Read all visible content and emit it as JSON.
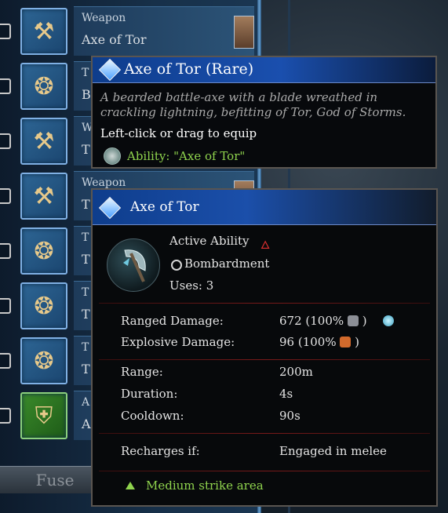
{
  "inventory": {
    "rows": [
      {
        "type": "Weapon",
        "name": "Axe of Tor",
        "kind": "axes"
      },
      {
        "type": "T",
        "name": "B",
        "kind": "talisman"
      },
      {
        "type": "W",
        "name": "T",
        "kind": "axes"
      },
      {
        "type": "Weapon",
        "name": "T",
        "kind": "axes"
      },
      {
        "type": "T",
        "name": "T",
        "kind": "talisman"
      },
      {
        "type": "T",
        "name": "T",
        "kind": "talisman"
      },
      {
        "type": "T",
        "name": "T",
        "kind": "talisman"
      },
      {
        "type": "A",
        "name": "A",
        "kind": "armor"
      }
    ],
    "fuse_label": "Fuse"
  },
  "tooltip_item": {
    "title": "Axe of Tor (Rare)",
    "description": "A bearded battle-axe with a blade wreathed in crackling lightning, befitting of Tor, God of Storms.",
    "equip_hint": "Left-click or drag to equip",
    "ability": "Ability: \"Axe of Tor\""
  },
  "tooltip_ability": {
    "title": "Axe of Tor",
    "ability_type": "Active Ability",
    "category": "Bombardment",
    "uses": "Uses: 3",
    "stats": [
      {
        "label": "Ranged Damage:",
        "value": "672  (100%"
      },
      {
        "label": "Explosive Damage:",
        "value": "96  (100%"
      },
      {
        "label": "Range:",
        "value": "200m"
      },
      {
        "label": "Duration:",
        "value": "4s"
      },
      {
        "label": "Cooldown:",
        "value": "90s"
      },
      {
        "label": "Recharges if:",
        "value": "Engaged in melee"
      }
    ],
    "paren_close": ")",
    "area": "Medium strike area"
  },
  "colors": {
    "ability_green": "#8fd34d",
    "header_blue": "#1a4fae",
    "separator_red": "#7a1a1a"
  }
}
